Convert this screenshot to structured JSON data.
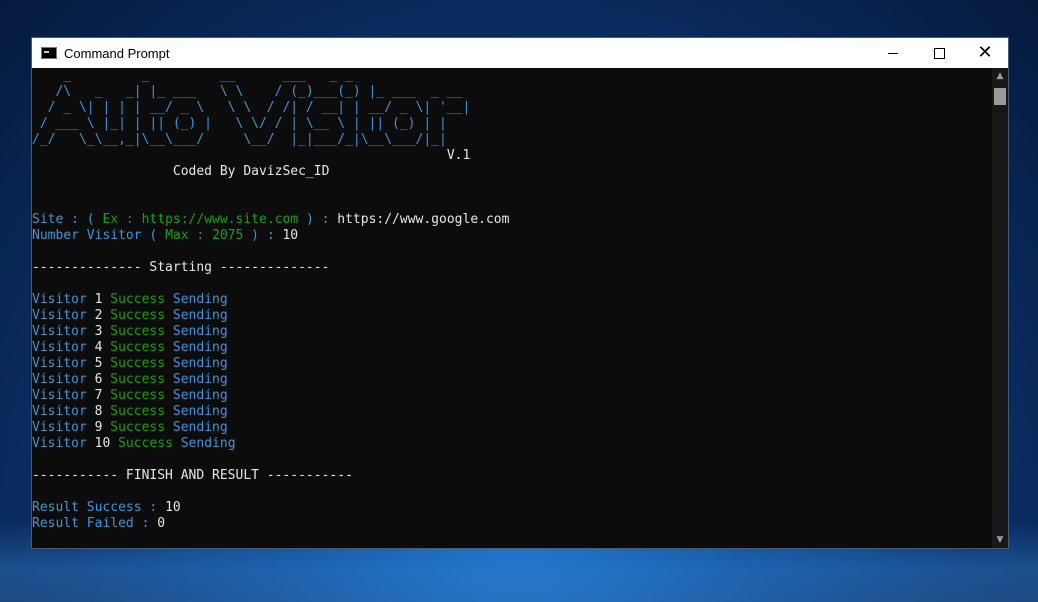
{
  "window": {
    "title": "Command Prompt",
    "icons": {
      "app": "cmd-icon",
      "minimize": "minimize-icon",
      "maximize": "maximize-icon",
      "close": "close-icon"
    },
    "close_glyph": "✕"
  },
  "console": {
    "banner": [
      "    _         _         __      ___   _ _           ",
      "   /\\   _   _| |_ ___   \\ \\    / (_)___(_) |_ ___  _ __",
      "  / _ \\| | | | __/ _ \\   \\ \\  / /| / __| | __/ _ \\| '__|",
      " / ___ \\ |_| | || (_) |   \\ \\/ / | \\__ \\ | || (_) | |",
      "/_/   \\_\\__,_|\\__\\___/     \\__/  |_|___/_|\\__\\___/|_|"
    ],
    "version": "                                                     V.1",
    "coded_by": "                  Coded By DavizSec_ID",
    "site_prompt": {
      "label": "Site : ( ",
      "ex": "Ex : https://www.site.com",
      "close": " ) : ",
      "value": "https://www.google.com"
    },
    "visitor_prompt": {
      "label": "Number Visitor ( ",
      "max": "Max : 2075",
      "close": " ) : ",
      "value": "10"
    },
    "starting": "-------------- Starting --------------",
    "visitors": [
      {
        "label": "Visitor",
        "num": "1",
        "status": "Success",
        "action": "Sending"
      },
      {
        "label": "Visitor",
        "num": "2",
        "status": "Success",
        "action": "Sending"
      },
      {
        "label": "Visitor",
        "num": "3",
        "status": "Success",
        "action": "Sending"
      },
      {
        "label": "Visitor",
        "num": "4",
        "status": "Success",
        "action": "Sending"
      },
      {
        "label": "Visitor",
        "num": "5",
        "status": "Success",
        "action": "Sending"
      },
      {
        "label": "Visitor",
        "num": "6",
        "status": "Success",
        "action": "Sending"
      },
      {
        "label": "Visitor",
        "num": "7",
        "status": "Success",
        "action": "Sending"
      },
      {
        "label": "Visitor",
        "num": "8",
        "status": "Success",
        "action": "Sending"
      },
      {
        "label": "Visitor",
        "num": "9",
        "status": "Success",
        "action": "Sending"
      },
      {
        "label": "Visitor",
        "num": "10",
        "status": "Success",
        "action": "Sending"
      }
    ],
    "finish": "----------- FINISH AND RESULT -----------",
    "result_success": {
      "label": "Result Success : ",
      "value": "10"
    },
    "result_failed": {
      "label": "Result Failed : ",
      "value": "0"
    }
  },
  "colors": {
    "console_bg": "#0c0c0c",
    "cyan": "#3a96dd",
    "green": "#13a10e",
    "white": "#e6e6e6"
  }
}
